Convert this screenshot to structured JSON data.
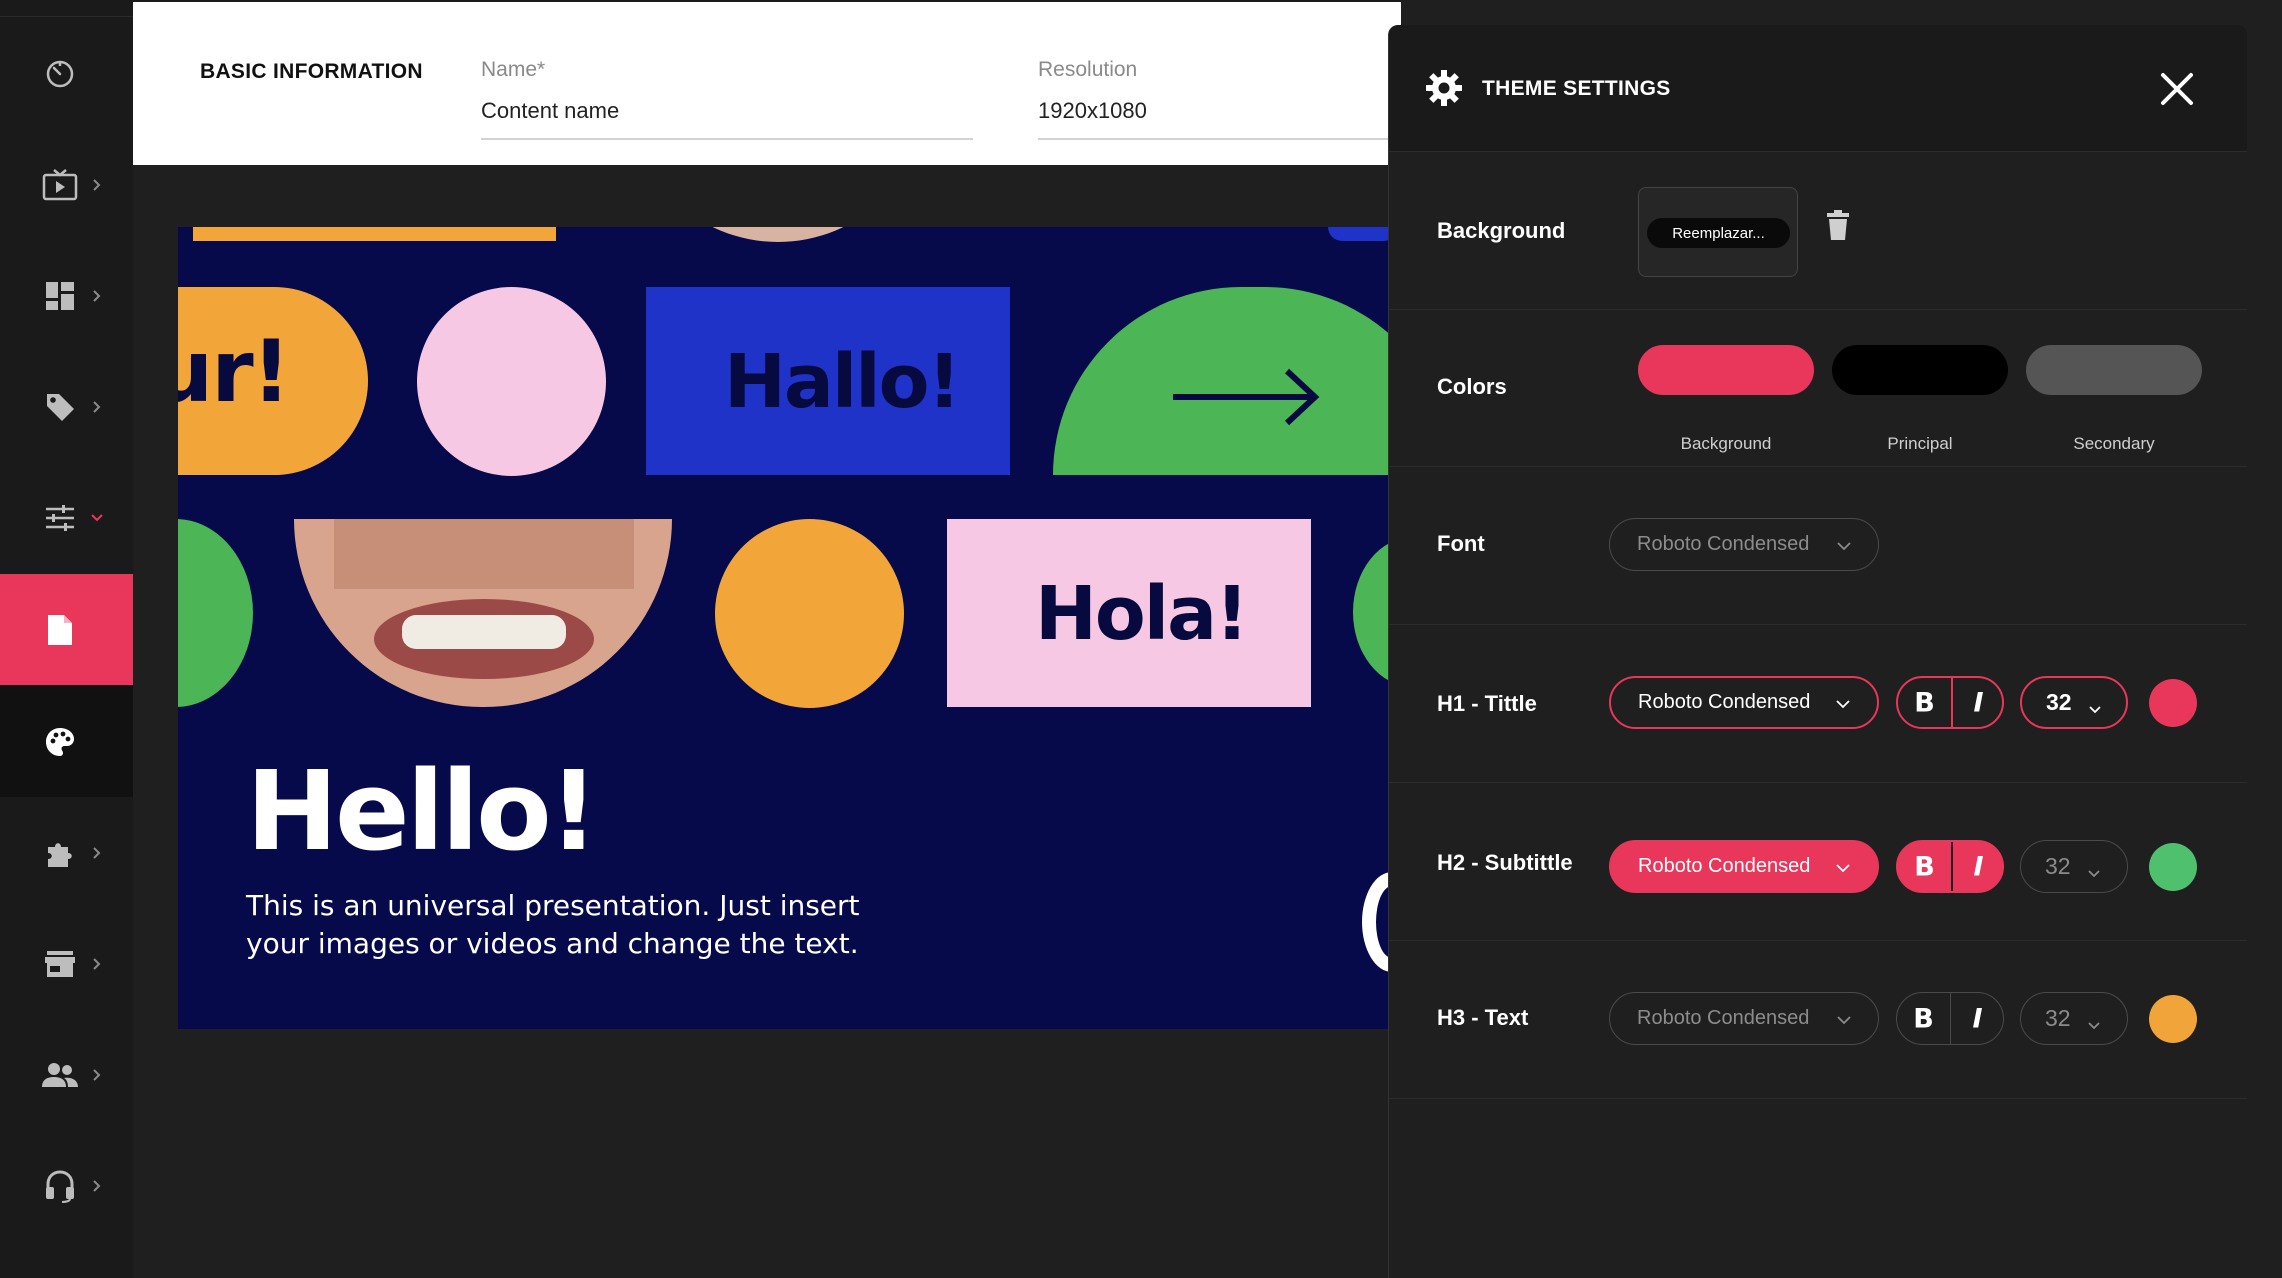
{
  "sidebar": {
    "items": [
      {
        "name": "dashboard-icon",
        "chevron": false,
        "state": "normal"
      },
      {
        "name": "tv-play-icon",
        "chevron": true,
        "state": "normal"
      },
      {
        "name": "layout-grid-icon",
        "chevron": true,
        "state": "normal"
      },
      {
        "name": "tag-icon",
        "chevron": true,
        "state": "normal"
      },
      {
        "name": "sliders-icon",
        "chevron": true,
        "chevron_color": "#e8375a",
        "state": "normal"
      },
      {
        "name": "document-icon",
        "chevron": false,
        "state": "active"
      },
      {
        "name": "palette-icon",
        "chevron": false,
        "state": "selected"
      },
      {
        "name": "puzzle-icon",
        "chevron": true,
        "state": "normal"
      },
      {
        "name": "store-icon",
        "chevron": true,
        "state": "normal"
      },
      {
        "name": "users-icon",
        "chevron": true,
        "state": "normal"
      },
      {
        "name": "headset-icon",
        "chevron": true,
        "state": "normal"
      }
    ]
  },
  "header": {
    "title": "BASIC INFORMATION",
    "name_label": "Name*",
    "name_value": "Content name",
    "resolution_label": "Resolution",
    "resolution_value": "1920x1080"
  },
  "preview": {
    "hallo": "Hallo!",
    "hola": "Hola!",
    "fragment": "ur!",
    "headline": "Hello!",
    "body": "This is an universal presentation. Just insert your images or videos and change the text."
  },
  "panel": {
    "title": "THEME SETTINGS",
    "background": {
      "label": "Background",
      "replace_label": "Reemplazar..."
    },
    "colors": {
      "label": "Colors",
      "swatches": [
        {
          "label": "Background",
          "color": "#e8375a"
        },
        {
          "label": "Principal",
          "color": "#000000"
        },
        {
          "label": "Secondary",
          "color": "#555555"
        }
      ]
    },
    "font": {
      "label": "Font",
      "value": "Roboto Condensed"
    },
    "styles": [
      {
        "label": "H1 - Tittle",
        "font": "Roboto Condensed",
        "bold": "B",
        "italic": "I",
        "size": "32",
        "color": "#e8375a",
        "state": "outlined"
      },
      {
        "label": "H2 - Subtittle",
        "font": "Roboto Condensed",
        "bold": "B",
        "italic": "I",
        "size": "32",
        "color": "#4fc16e",
        "state": "filled"
      },
      {
        "label": "H3 - Text",
        "font": "Roboto Condensed",
        "bold": "B",
        "italic": "I",
        "size": "32",
        "color": "#f1a43a",
        "state": "default"
      }
    ]
  },
  "colors": {
    "accent": "#e8375a",
    "navy": "#060a4a",
    "orange": "#f2a63a",
    "pink": "#f7c8e3",
    "blue": "#1f33c9",
    "green": "#4cb556"
  }
}
